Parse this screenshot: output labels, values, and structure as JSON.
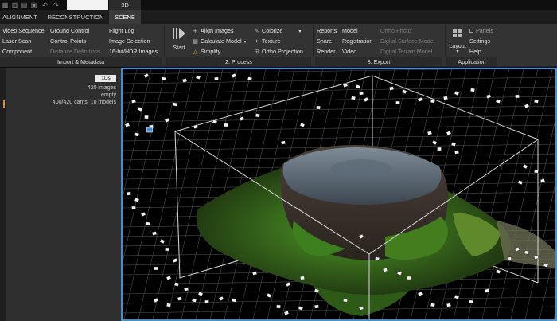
{
  "titlebar": {
    "doc_tab_label": "",
    "view_tab_label": "3D"
  },
  "ribbon_tabs": [
    {
      "label": "ALIGNMENT"
    },
    {
      "label": "RECONSTRUCTION"
    },
    {
      "label": "SCENE"
    }
  ],
  "import_group": {
    "label": "Import & Metadata",
    "col1": [
      "Video Sequence",
      "Laser Scan",
      "Component"
    ],
    "col2": [
      "Ground Control",
      "Control Points",
      "Distance Definitions"
    ],
    "col3": [
      "Flight Log",
      "Image Selection",
      "16-bit/HDR Images"
    ]
  },
  "process_group": {
    "label": "2. Process",
    "start_label": "Start",
    "col1": [
      "Align Images",
      "Calculate Model",
      "Simplify"
    ],
    "col2": [
      "Colorize",
      "Texture",
      "Ortho Projection"
    ]
  },
  "export_group": {
    "label": "3. Export",
    "col1": [
      "Reports",
      "Share",
      "Render"
    ],
    "col2": [
      "Model",
      "Registration",
      "Video"
    ],
    "col3": [
      "Ortho Photo",
      "Digital Surface Model",
      "Digital Terrain Model"
    ]
  },
  "application_group": {
    "label": "Application",
    "layout_label": "Layout",
    "items": [
      "Panels",
      "Settings",
      "Help"
    ]
  },
  "left_panel": {
    "badge": "1Ds",
    "lines": [
      "420 images",
      "empty",
      "400/420 cams, 10 models"
    ]
  },
  "colors": {
    "accent": "#3d8fd6",
    "moss": "#3f7d1f",
    "stump": "#5b6a78",
    "marker": "#e58a1f"
  }
}
